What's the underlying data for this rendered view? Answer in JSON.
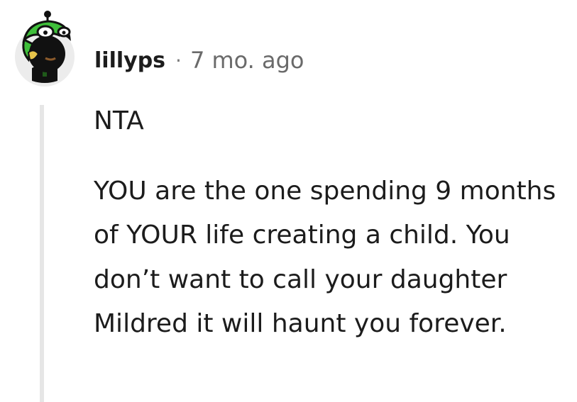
{
  "comment": {
    "username": "lillyps",
    "separator": "·",
    "timestamp": "7 mo. ago",
    "avatar_icon": "frog-hat-avatar-icon",
    "paragraphs": [
      "NTA",
      "YOU are the one spending 9 months of YOUR life creating a child. You don’t want to call your daughter Mildred it will haunt you forever."
    ],
    "colors": {
      "text": "#1c1c1c",
      "meta": "#6a6a6a",
      "thread_line": "#e6e6e6",
      "avatar_green": "#3fbf3a"
    }
  }
}
